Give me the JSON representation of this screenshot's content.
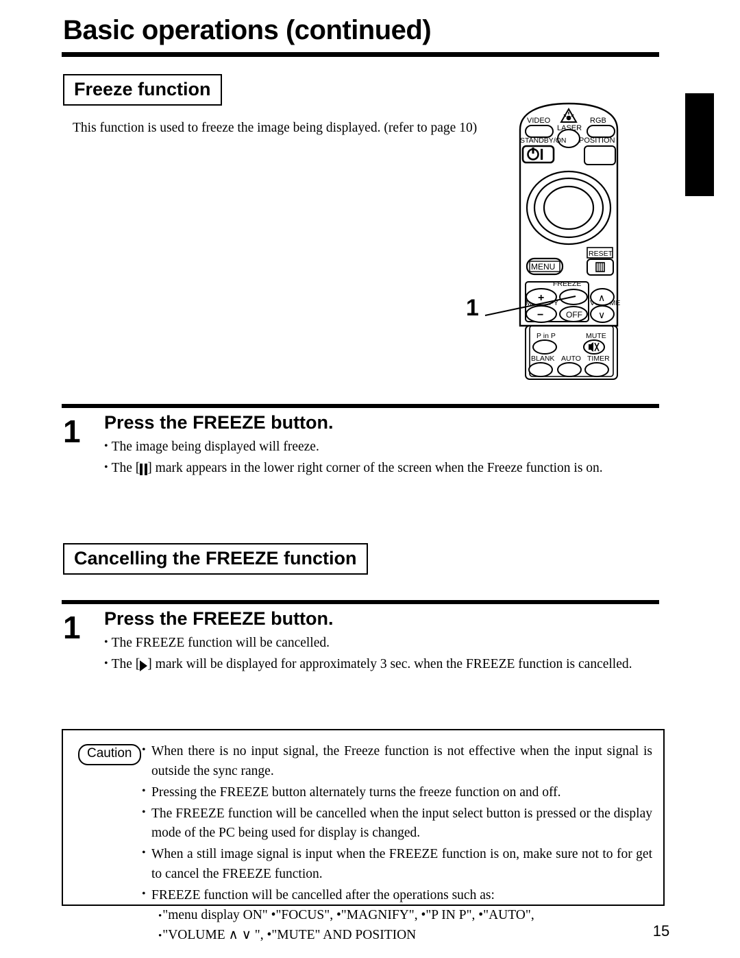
{
  "page": {
    "title": "Basic operations (continued)",
    "number": "15"
  },
  "sections": {
    "freeze": {
      "heading": "Freeze function",
      "intro": "This function is used to freeze the image being displayed. (refer to page 10)",
      "step": {
        "number": "1",
        "heading": "Press the FREEZE button.",
        "bullets": {
          "first": "The image being displayed will freeze.",
          "second_prefix": "The [",
          "second_suffix": "] mark appears in the lower right corner of the screen when the Freeze function is on."
        }
      }
    },
    "cancel": {
      "heading": "Cancelling the FREEZE function",
      "step": {
        "number": "1",
        "heading": "Press the FREEZE button.",
        "bullets": {
          "first": "The FREEZE function will be cancelled.",
          "second_prefix": "The [",
          "second_suffix": "] mark will be displayed for approximately 3 sec. when the FREEZE function is cancelled."
        }
      }
    }
  },
  "caution": {
    "label": "Caution",
    "items": [
      "When there is no input signal, the Freeze function is not effective when the input signal is outside the sync range.",
      "Pressing the FREEZE button alternately turns the freeze function on and off.",
      "The FREEZE function will be cancelled when the input select button is pressed or the display mode of the PC being used for display is changed.",
      "When a still image signal is input when the FREEZE function is on, make sure not to for get to cancel the FREEZE function.",
      "FREEZE function will be cancelled after the operations such as:"
    ],
    "sub_items": [
      "\"menu display ON\" •\"FOCUS\", •\"MAGNIFY\", •\"P IN P\", •\"AUTO\",",
      "\"VOLUME ∧  ∨ \", •\"MUTE\" AND POSITION"
    ]
  },
  "callout": {
    "label": "1"
  },
  "remote": {
    "labels": {
      "video": "VIDEO",
      "laser": "LASER",
      "rgb": "RGB",
      "standby_on": "STANDBY/ON",
      "position": "POSITION",
      "reset": "RESET",
      "menu": "MENU",
      "freeze": "FREEZE",
      "magnify": "MAGNIFY",
      "volume": "VOLUME",
      "plus": "+",
      "minus": "−",
      "off": "OFF",
      "vol_up": "∧",
      "vol_down": "∨",
      "pinp": "P in P",
      "mute": "MUTE",
      "blank": "BLANK",
      "auto": "AUTO",
      "timer": "TIMER"
    }
  },
  "colors": {
    "ink": "#000000",
    "paper": "#ffffff"
  }
}
